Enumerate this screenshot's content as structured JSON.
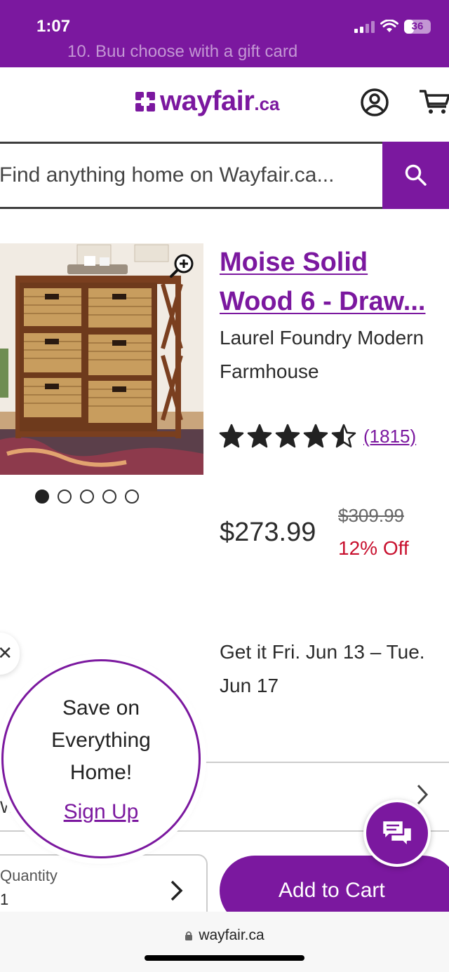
{
  "status_bar": {
    "time": "1:07",
    "battery": "36",
    "battery_level": 0.36,
    "promo_ghost": "10. Buu choose with a gift card"
  },
  "header": {
    "logo_word": "wayfair",
    "logo_tld": ".ca"
  },
  "search": {
    "placeholder": "Find anything home on Wayfair.ca..."
  },
  "carousel": {
    "total": 5,
    "active": 0
  },
  "product": {
    "title_line1": "Moise Solid",
    "title_line2": "Wood 6 - Draw...",
    "brand_line1": "Laurel Foundry Modern",
    "brand_line2": "Farmhouse",
    "rating": 4.5,
    "review_count": "(1815)",
    "price": "$273.99",
    "original_price": "$309.99",
    "discount": "12% Off",
    "delivery_line1": "Get it Fri. Jun 13 – Tue.",
    "delivery_line2": "Jun 17"
  },
  "option_row": {
    "letter": "W"
  },
  "quantity": {
    "label": "Quantity",
    "value": "1"
  },
  "cart": {
    "button_label": "Add to Cart"
  },
  "signup": {
    "line1": "Save on",
    "line2": "Everything",
    "line3": "Home!",
    "link": "Sign Up"
  },
  "browser": {
    "url": "wayfair.ca"
  },
  "colors": {
    "brand": "#7b189f",
    "sale": "#c8102e"
  }
}
